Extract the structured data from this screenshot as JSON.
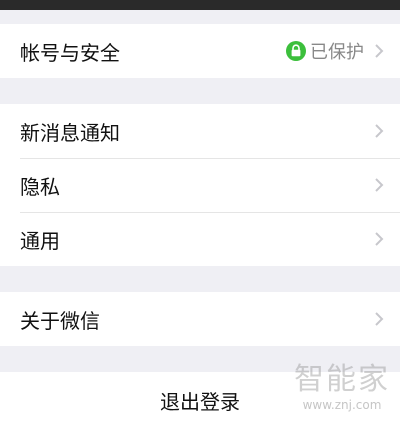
{
  "menu": {
    "account": {
      "label": "帐号与安全",
      "status": "已保护",
      "status_icon": "lock-icon",
      "status_color": "#3cbf3c"
    },
    "group2": [
      {
        "label": "新消息通知"
      },
      {
        "label": "隐私"
      },
      {
        "label": "通用"
      }
    ],
    "about": {
      "label": "关于微信"
    },
    "logout": {
      "label": "退出登录"
    }
  },
  "watermark": {
    "text": "智能家",
    "url": "www.znj.com"
  },
  "colors": {
    "background": "#efeff4",
    "card": "#ffffff",
    "chevron": "#c7c7cc"
  }
}
